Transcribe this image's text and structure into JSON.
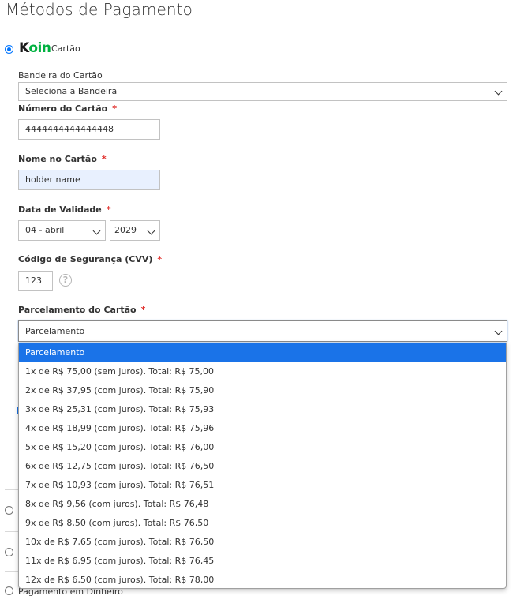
{
  "page": {
    "title": "Métodos de Pagamento"
  },
  "koin": {
    "logo_text": "Koin",
    "logo_k": "K",
    "logo_rest": "oin",
    "method_label": "Cartão",
    "brand_color": "#00b140"
  },
  "form": {
    "brand_label": "Bandeira do Cartão",
    "brand_value": "Seleciona a Bandeira",
    "number_label": "Número do Cartão",
    "number_value": "4444444444444448",
    "name_label": "Nome no Cartão",
    "name_value": "holder name",
    "expiry_label": "Data de Validade",
    "expiry_month": "04 - abril",
    "expiry_year": "2029",
    "cvv_label": "Código de Segurança (CVV)",
    "cvv_value": "123",
    "cvv_help_icon": "?",
    "installment_label": "Parcelamento do Cartão",
    "installment_value": "Parcelamento",
    "required_mark": "*"
  },
  "dropdown": {
    "selected_index": 0,
    "highlight_color": "#1a73e8",
    "options": [
      "Parcelamento",
      "1x de R$ 75,00 (sem juros). Total: R$ 75,00",
      "2x de R$ 37,95 (com juros). Total: R$ 75,90",
      "3x de R$ 25,31 (com juros). Total: R$ 75,93",
      "4x de R$ 18,99 (com juros). Total: R$ 75,96",
      "5x de R$ 15,20 (com juros). Total: R$ 76,00",
      "6x de R$ 12,75 (com juros). Total: R$ 76,50",
      "7x de R$ 10,93 (com juros). Total: R$ 76,51",
      "8x de R$ 9,56 (com juros). Total: R$ 76,48",
      "9x de R$ 8,50 (com juros). Total: R$ 76,50",
      "10x de R$ 7,65 (com juros). Total: R$ 76,50",
      "11x de R$ 6,95 (com juros). Total: R$ 76,45",
      "12x de R$ 6,50 (com juros). Total: R$ 78,00"
    ]
  },
  "other_methods": {
    "cash_label": "Pagamento em Dinheiro"
  }
}
